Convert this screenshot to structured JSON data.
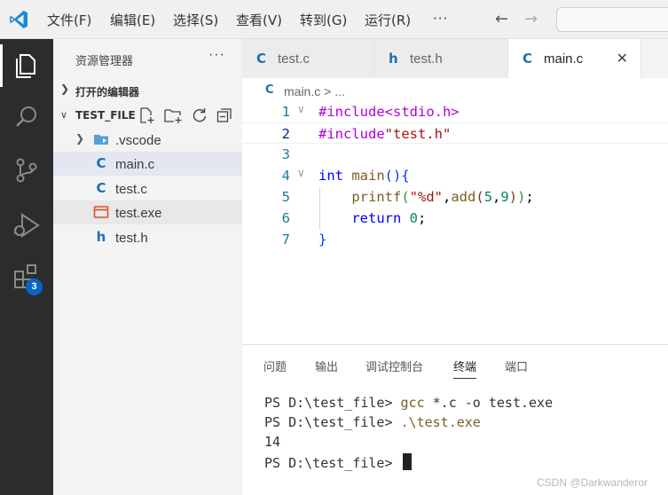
{
  "titlebar": {
    "menu": [
      "文件(F)",
      "编辑(E)",
      "选择(S)",
      "查看(V)",
      "转到(G)",
      "运行(R)",
      "···"
    ],
    "back_arrow": "←",
    "forward_arrow": "→"
  },
  "activity_bar": {
    "icons": [
      "explorer-icon",
      "search-icon",
      "source-control-icon",
      "run-debug-icon",
      "extensions-icon"
    ],
    "extensions_badge": "3"
  },
  "sidebar": {
    "title": "资源管理器",
    "more": "···",
    "open_editors_label": "打开的编辑器",
    "folder_label": "TEST_FILE",
    "files": [
      {
        "name": ".vscode",
        "icon": "folder-vscode-icon",
        "glyph": ""
      },
      {
        "name": "main.c",
        "icon": "c-file-icon",
        "glyph": "C"
      },
      {
        "name": "test.c",
        "icon": "c-file-icon",
        "glyph": "C"
      },
      {
        "name": "test.exe",
        "icon": "exe-file-icon",
        "glyph": ""
      },
      {
        "name": "test.h",
        "icon": "h-file-icon",
        "glyph": "h"
      }
    ]
  },
  "tabs": [
    {
      "name": "test.c",
      "glyph": "C"
    },
    {
      "name": "test.h",
      "glyph": "h"
    },
    {
      "name": "main.c",
      "glyph": "C",
      "close": "✕"
    }
  ],
  "breadcrumb": {
    "glyph": "C",
    "file": "main.c",
    "sep": " > ..."
  },
  "editor": {
    "line_numbers": [
      "1",
      "2",
      "3",
      "4",
      "5",
      "6",
      "7"
    ],
    "fold_markers": [
      "∨",
      "",
      "",
      "∨",
      "",
      "",
      ""
    ]
  },
  "panel": {
    "tabs": [
      "问题",
      "输出",
      "调试控制台",
      "终端",
      "端口"
    ],
    "active_tab": "终端",
    "terminal": {
      "prompt1": "PS D:\\test_file> ",
      "cmd1": "gcc",
      "args1": " *.c -o test.exe",
      "prompt2": "PS D:\\test_file> ",
      "cmd2": ".\\test.exe",
      "output": "14",
      "prompt3": "PS D:\\test_file> "
    }
  },
  "watermark": "CSDN @Darkwanderor",
  "colors": {
    "accent": "#0a64c8",
    "activity_bg": "#2c2c2c",
    "sidebar_bg": "#f3f3f3",
    "selected_row": "#e4e6f1",
    "c_icon": "#1f6fb8",
    "exe_icon": "#d94f2b"
  }
}
